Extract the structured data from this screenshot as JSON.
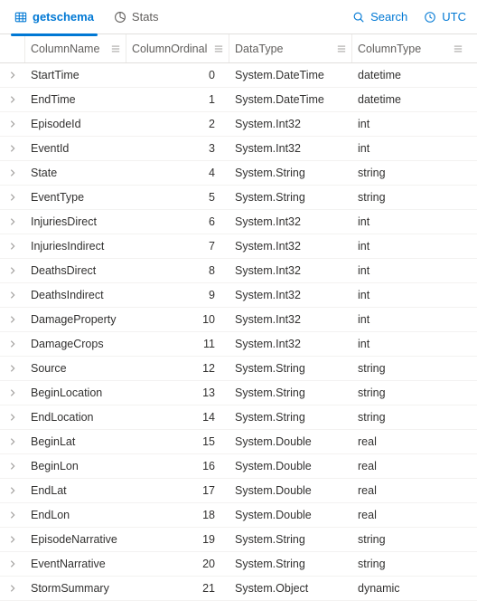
{
  "tabs": {
    "getschema": "getschema",
    "stats": "Stats"
  },
  "actions": {
    "search": "Search",
    "timezone": "UTC"
  },
  "columns": {
    "name": "ColumnName",
    "ordinal": "ColumnOrdinal",
    "datatype": "DataType",
    "columntype": "ColumnType"
  },
  "rows": [
    {
      "name": "StartTime",
      "ordinal": 0,
      "datatype": "System.DateTime",
      "columntype": "datetime"
    },
    {
      "name": "EndTime",
      "ordinal": 1,
      "datatype": "System.DateTime",
      "columntype": "datetime"
    },
    {
      "name": "EpisodeId",
      "ordinal": 2,
      "datatype": "System.Int32",
      "columntype": "int"
    },
    {
      "name": "EventId",
      "ordinal": 3,
      "datatype": "System.Int32",
      "columntype": "int"
    },
    {
      "name": "State",
      "ordinal": 4,
      "datatype": "System.String",
      "columntype": "string"
    },
    {
      "name": "EventType",
      "ordinal": 5,
      "datatype": "System.String",
      "columntype": "string"
    },
    {
      "name": "InjuriesDirect",
      "ordinal": 6,
      "datatype": "System.Int32",
      "columntype": "int"
    },
    {
      "name": "InjuriesIndirect",
      "ordinal": 7,
      "datatype": "System.Int32",
      "columntype": "int"
    },
    {
      "name": "DeathsDirect",
      "ordinal": 8,
      "datatype": "System.Int32",
      "columntype": "int"
    },
    {
      "name": "DeathsIndirect",
      "ordinal": 9,
      "datatype": "System.Int32",
      "columntype": "int"
    },
    {
      "name": "DamageProperty",
      "ordinal": 10,
      "datatype": "System.Int32",
      "columntype": "int"
    },
    {
      "name": "DamageCrops",
      "ordinal": 11,
      "datatype": "System.Int32",
      "columntype": "int"
    },
    {
      "name": "Source",
      "ordinal": 12,
      "datatype": "System.String",
      "columntype": "string"
    },
    {
      "name": "BeginLocation",
      "ordinal": 13,
      "datatype": "System.String",
      "columntype": "string"
    },
    {
      "name": "EndLocation",
      "ordinal": 14,
      "datatype": "System.String",
      "columntype": "string"
    },
    {
      "name": "BeginLat",
      "ordinal": 15,
      "datatype": "System.Double",
      "columntype": "real"
    },
    {
      "name": "BeginLon",
      "ordinal": 16,
      "datatype": "System.Double",
      "columntype": "real"
    },
    {
      "name": "EndLat",
      "ordinal": 17,
      "datatype": "System.Double",
      "columntype": "real"
    },
    {
      "name": "EndLon",
      "ordinal": 18,
      "datatype": "System.Double",
      "columntype": "real"
    },
    {
      "name": "EpisodeNarrative",
      "ordinal": 19,
      "datatype": "System.String",
      "columntype": "string"
    },
    {
      "name": "EventNarrative",
      "ordinal": 20,
      "datatype": "System.String",
      "columntype": "string"
    },
    {
      "name": "StormSummary",
      "ordinal": 21,
      "datatype": "System.Object",
      "columntype": "dynamic"
    }
  ]
}
